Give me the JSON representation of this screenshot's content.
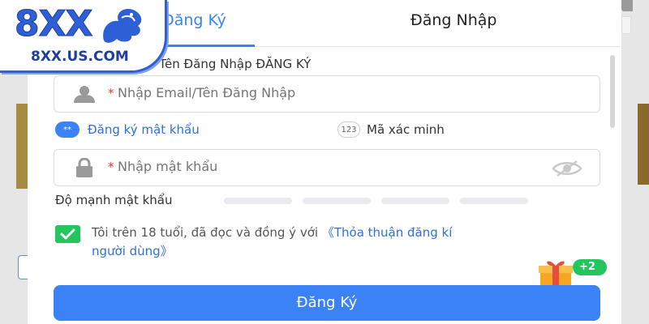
{
  "tabs": {
    "register": "Đăng Ký",
    "login": "Đăng Nhập"
  },
  "logo": {
    "brand": "8XX",
    "site": "8XX.US.COM"
  },
  "form": {
    "username_label": "Tên Đăng Nhập ĐĂNG KÝ",
    "username_placeholder": "Nhập Email/Tên Đăng Nhập",
    "required_mark": "*",
    "option_password": "Đăng ký mật khẩu",
    "option_password_badge": "**",
    "option_code": "Mã xác minh",
    "option_code_badge": "123",
    "password_placeholder": "Nhập mật khẩu",
    "strength_label": "Độ mạnh mật khẩu",
    "agree_text": "Tôi trên 18 tuổi, đã đọc và đồng ý với",
    "agree_link_1": "《Thỏa thuận đăng kí",
    "agree_link_2": "người dùng》",
    "gift_badge": "+2",
    "submit": "Đăng Ký"
  },
  "colors": {
    "accent": "#3b82f6",
    "check": "#22c55e",
    "required": "#e53935"
  },
  "icons": [
    "user-icon",
    "lock-icon",
    "eye-off-icon",
    "checkbox-checked-icon",
    "gift-icon",
    "dragon-logo-icon"
  ]
}
